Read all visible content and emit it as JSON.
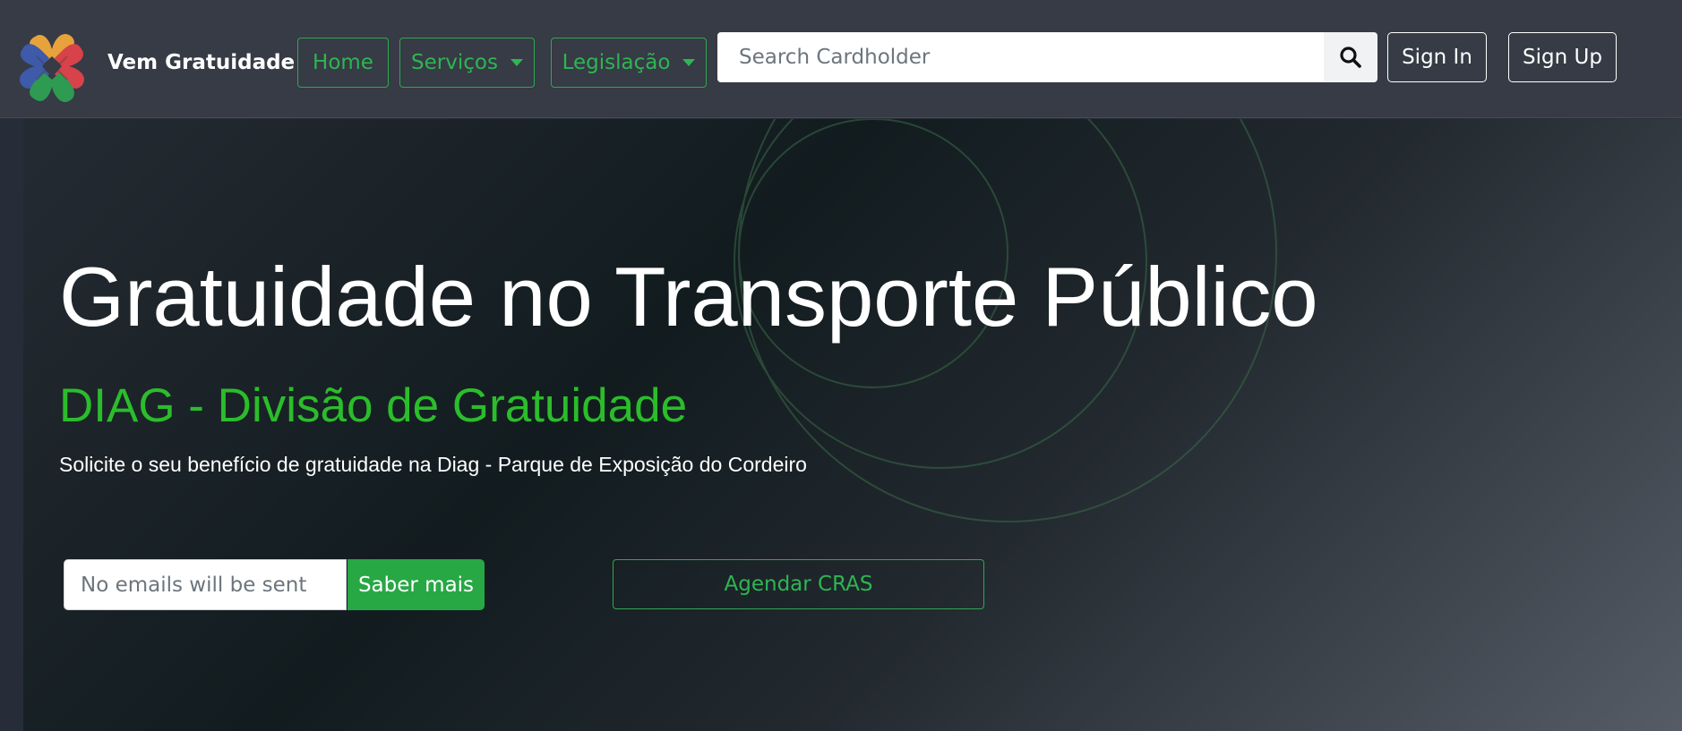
{
  "navbar": {
    "brand": "Vem Gratuidade",
    "logo_icon": "x-logo-icon",
    "items": [
      {
        "label": "Home",
        "dropdown": false
      },
      {
        "label": "Serviços",
        "dropdown": true
      },
      {
        "label": "Legislação",
        "dropdown": true
      }
    ],
    "search": {
      "placeholder": "Search Cardholder",
      "value": "",
      "icon": "search-icon"
    },
    "sign_in": "Sign In",
    "sign_up": "Sign Up"
  },
  "hero": {
    "title": "Gratuidade no Transporte Público",
    "subtitle": "DIAG - Divisão de Gratuidade",
    "description": "Solicite o seu benefício de gratuidade na Diag - Parque de Exposição do Cordeiro",
    "email": {
      "placeholder": "No emails will be sent",
      "value": ""
    },
    "saber_mais": "Saber mais",
    "agendar": "Agendar CRAS"
  },
  "colors": {
    "navbar_bg": "#363b45",
    "accent_green": "#28a745",
    "subtitle_green": "#2bbd2b",
    "outline_green": "#2fa84f",
    "text_white": "#ffffff"
  }
}
